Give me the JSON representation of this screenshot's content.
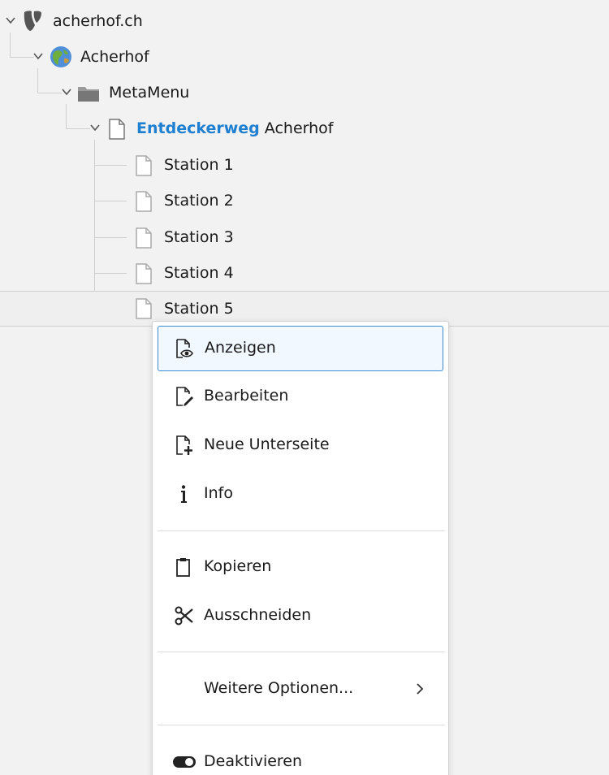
{
  "tree": {
    "root": {
      "label": "acherhof.ch",
      "icon": "typo3-logo-icon"
    },
    "site": {
      "label": "Acherhof",
      "icon": "globe-icon"
    },
    "folder": {
      "label": "MetaMenu",
      "icon": "folder-icon"
    },
    "page": {
      "label_highlight": "Entdeckerweg",
      "label_rest": " Acherhof",
      "icon": "page-icon"
    },
    "children": [
      {
        "label": "Station 1"
      },
      {
        "label": "Station 2"
      },
      {
        "label": "Station 3"
      },
      {
        "label": "Station 4"
      },
      {
        "label": "Station 5"
      }
    ]
  },
  "context_menu": {
    "items": [
      {
        "label": "Anzeigen",
        "icon": "view-page-icon"
      },
      {
        "label": "Bearbeiten",
        "icon": "edit-page-icon"
      },
      {
        "label": "Neue Unterseite",
        "icon": "new-subpage-icon"
      },
      {
        "label": "Info",
        "icon": "info-icon"
      },
      {
        "label": "Kopieren",
        "icon": "clipboard-icon"
      },
      {
        "label": "Ausschneiden",
        "icon": "scissors-icon"
      },
      {
        "label": "Weitere Optionen...",
        "icon": "chevron-right-icon"
      },
      {
        "label": "Deaktivieren",
        "icon": "toggle-icon"
      }
    ]
  },
  "colors": {
    "highlight": "#1f7fd1",
    "focus_border": "#3a8dd6"
  }
}
